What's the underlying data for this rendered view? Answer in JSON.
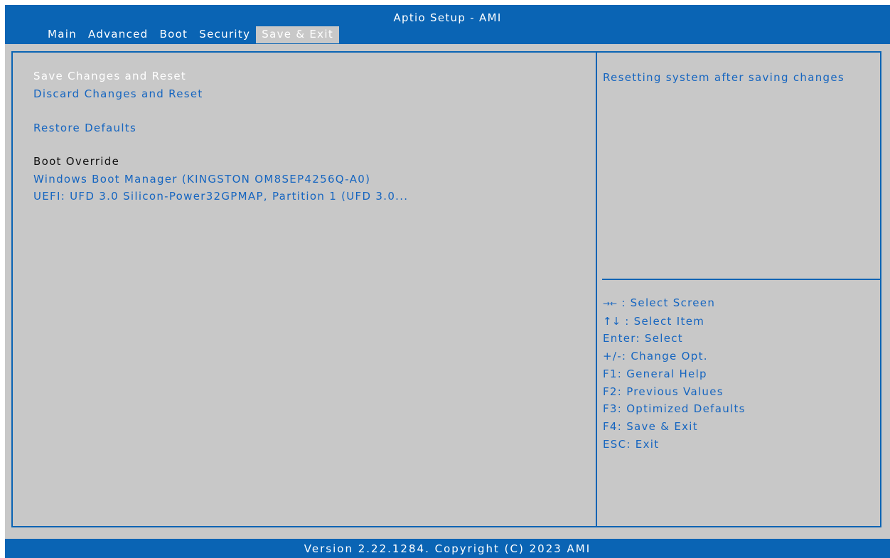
{
  "app": {
    "title": "Aptio Setup - AMI",
    "version": "Version 2.22.1284. Copyright (C) 2023 AMI"
  },
  "tabs": [
    {
      "label": "Main",
      "active": false
    },
    {
      "label": "Advanced",
      "active": false
    },
    {
      "label": "Boot",
      "active": false
    },
    {
      "label": "Security",
      "active": false
    },
    {
      "label": "Save & Exit",
      "active": true
    }
  ],
  "menu": {
    "save_changes_reset": "Save Changes and Reset",
    "discard_changes_reset": "Discard Changes and Reset",
    "restore_defaults": "Restore Defaults",
    "boot_override_heading": "Boot Override",
    "boot_option_1": "Windows Boot Manager (KINGSTON OM8SEP4256Q-A0)",
    "boot_option_2": "UEFI: UFD 3.0 Silicon-Power32GPMAP, Partition 1 (UFD 3.0..."
  },
  "help": {
    "description": "Resetting system after saving changes"
  },
  "keys": [
    {
      "icon": "left-right-arrows-icon",
      "glyph": "→←",
      "text": ": Select Screen"
    },
    {
      "icon": "up-down-arrows-icon",
      "glyph": "↑↓",
      "text": ": Select Item"
    },
    {
      "icon": null,
      "glyph": "",
      "text": "Enter: Select"
    },
    {
      "icon": null,
      "glyph": "",
      "text": "+/-: Change Opt."
    },
    {
      "icon": null,
      "glyph": "",
      "text": "F1: General Help"
    },
    {
      "icon": null,
      "glyph": "",
      "text": "F2: Previous Values"
    },
    {
      "icon": null,
      "glyph": "",
      "text": "F3: Optimized Defaults"
    },
    {
      "icon": null,
      "glyph": "",
      "text": "F4: Save & Exit"
    },
    {
      "icon": null,
      "glyph": "",
      "text": "ESC: Exit"
    }
  ],
  "colors": {
    "bar_blue": "#0a64b4",
    "background_gray": "#c8c8c8",
    "text_blue": "#1565c0",
    "selected_white": "#ffffff",
    "heading_black": "#111111"
  }
}
